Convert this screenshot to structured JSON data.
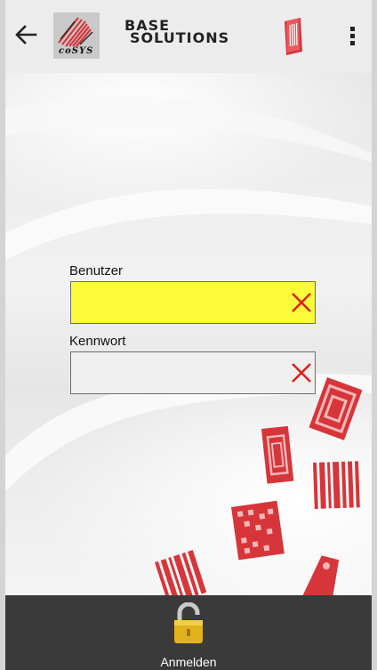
{
  "appbar": {
    "brand_line1": "BASE",
    "brand_line2": "SOLUTIONS",
    "logo_text": "coSYS"
  },
  "form": {
    "user_label": "Benutzer",
    "user_value": "",
    "user_bg": "#fbfb3a",
    "password_label": "Kennwort",
    "password_value": "",
    "password_bg": "#efefef",
    "clear_color": "#e0201c"
  },
  "bottombar": {
    "login_label": "Anmelden"
  },
  "colors": {
    "brand_red": "#d6353a",
    "lock_gold": "#e2b21a"
  }
}
